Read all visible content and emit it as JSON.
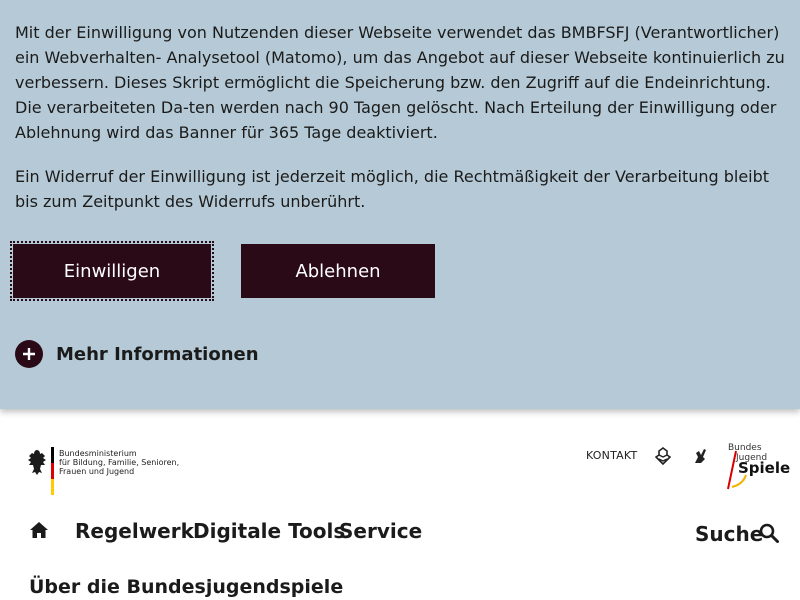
{
  "consent": {
    "paragraph1": "Mit der Einwilligung von Nutzenden dieser Webseite verwendet das BMBFSFJ (Verantwortlicher) ein Webverhalten- Analysetool (Matomo), um das Angebot auf dieser Webseite kontinuierlich zu verbessern. Dieses Skript ermöglicht die Speicherung bzw. den Zugriff auf die Endeinrichtung. Die verarbeiteten Da-ten werden nach 90 Tagen gelöscht. Nach Erteilung der Einwilligung oder Ablehnung wird das Banner für 365 Tage deaktiviert.",
    "paragraph2": "Ein Widerruf der Einwilligung ist jederzeit möglich, die Rechtmäßigkeit der Verarbeitung bleibt bis zum Zeitpunkt des Widerrufs unberührt.",
    "accept_label": "Einwilligen",
    "decline_label": "Ablehnen",
    "more_info_label": "Mehr Informationen",
    "background_color": "#b5cad6",
    "button_color": "#2b0a17"
  },
  "header": {
    "ministry_lines": [
      "Bundesministerium",
      "für Bildung, Familie, Senioren,",
      "Frauen und Jugend"
    ],
    "kontakt_label": "KONTAKT",
    "sign_language_icon": "sign-language-icon",
    "easy_language_icon": "easy-language-icon",
    "brand_line1": "Bundes",
    "brand_line2": "Jugend",
    "brand_line3": "Spiele",
    "flag_colors": [
      "#000000",
      "#dd0000",
      "#ffcc00"
    ]
  },
  "nav": {
    "home_icon": "home-icon",
    "items": [
      "Regelwerk",
      "Digitale Tools",
      "Service"
    ],
    "search_label": "Suche"
  },
  "page": {
    "subtitle": "Über die Bundesjugendspiele"
  }
}
